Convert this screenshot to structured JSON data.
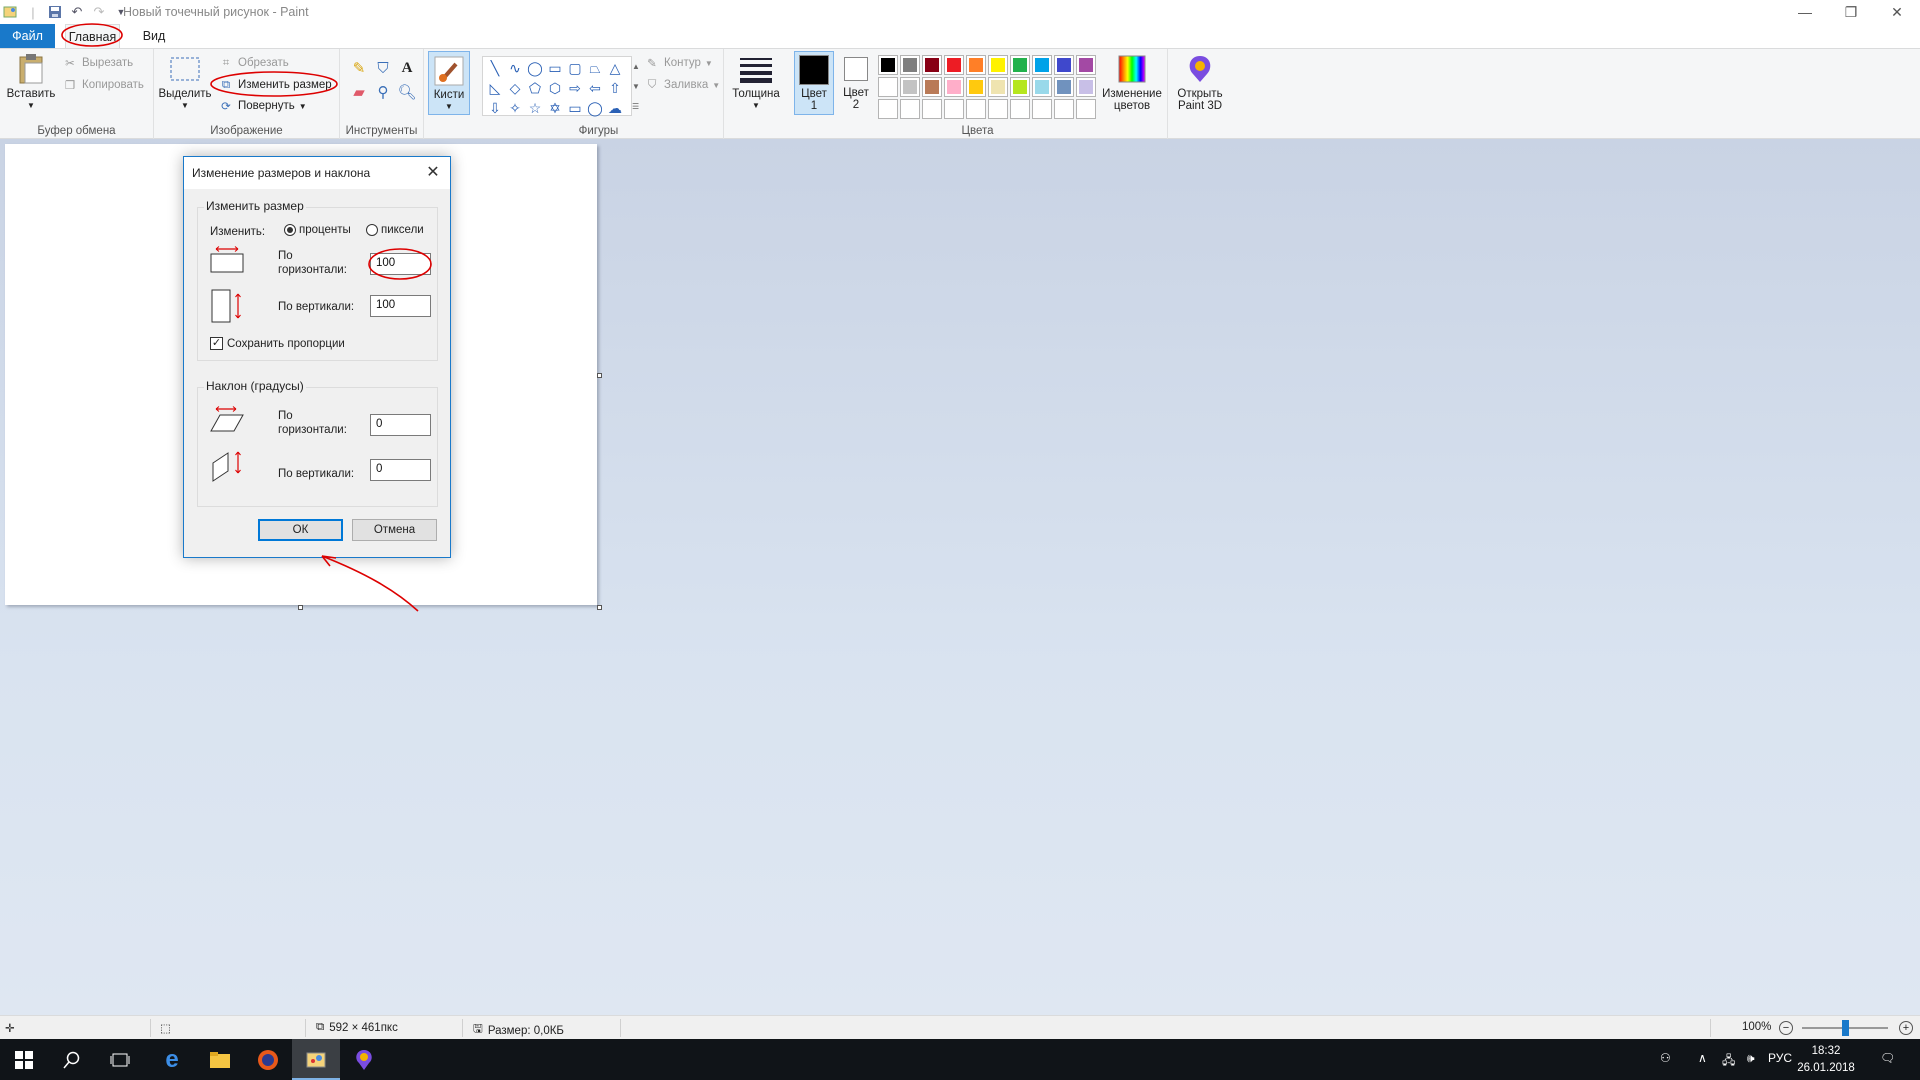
{
  "window": {
    "title": "Новый точечный рисунок - Paint"
  },
  "tabs": {
    "file": "Файл",
    "home": "Главная",
    "view": "Вид"
  },
  "ribbon": {
    "clipboard": {
      "group": "Буфер обмена",
      "paste": "Вставить",
      "cut": "Вырезать",
      "copy": "Копировать"
    },
    "image": {
      "group": "Изображение",
      "select": "Выделить",
      "crop": "Обрезать",
      "resize": "Изменить размер",
      "rotate": "Повернуть"
    },
    "tools": {
      "group": "Инструменты"
    },
    "brushes": "Кисти",
    "shapes": {
      "group": "Фигуры",
      "outline": "Контур",
      "fill": "Заливка"
    },
    "size": "Толщина",
    "color1": "Цвет 1",
    "color2": "Цвет 2",
    "colors": {
      "group": "Цвета",
      "edit": "Изменение цветов",
      "paint3d": "Открыть Paint 3D"
    }
  },
  "palette": [
    "#000000",
    "#7f7f7f",
    "#880015",
    "#ed1c24",
    "#ff7f27",
    "#fff200",
    "#22b14c",
    "#00a2e8",
    "#3f48cc",
    "#a349a4",
    "#ffffff",
    "#c3c3c3",
    "#b97a57",
    "#ffaec9",
    "#ffc90e",
    "#efe4b0",
    "#b5e61d",
    "#99d9ea",
    "#7092be",
    "#c8bfe7",
    "#ffffff",
    "#ffffff",
    "#ffffff",
    "#ffffff",
    "#ffffff",
    "#ffffff",
    "#ffffff",
    "#ffffff",
    "#ffffff",
    "#ffffff"
  ],
  "dialog": {
    "title": "Изменение размеров и наклона",
    "resize_group": "Изменить размер",
    "by_label": "Изменить:",
    "percent": "проценты",
    "pixels": "пиксели",
    "horizontal": "По горизонтали:",
    "vertical": "По вертикали:",
    "horiz_value": "100",
    "vert_value": "100",
    "keep_ratio": "Сохранить пропорции",
    "skew_group": "Наклон (градусы)",
    "skew_h": "0",
    "skew_v": "0",
    "ok": "ОК",
    "cancel": "Отмена"
  },
  "status": {
    "dimensions": "592 × 461пкс",
    "filesize": "Размер: 0,0КБ",
    "zoom": "100%"
  },
  "taskbar": {
    "lang": "РУС",
    "time": "18:32",
    "date": "26.01.2018"
  }
}
